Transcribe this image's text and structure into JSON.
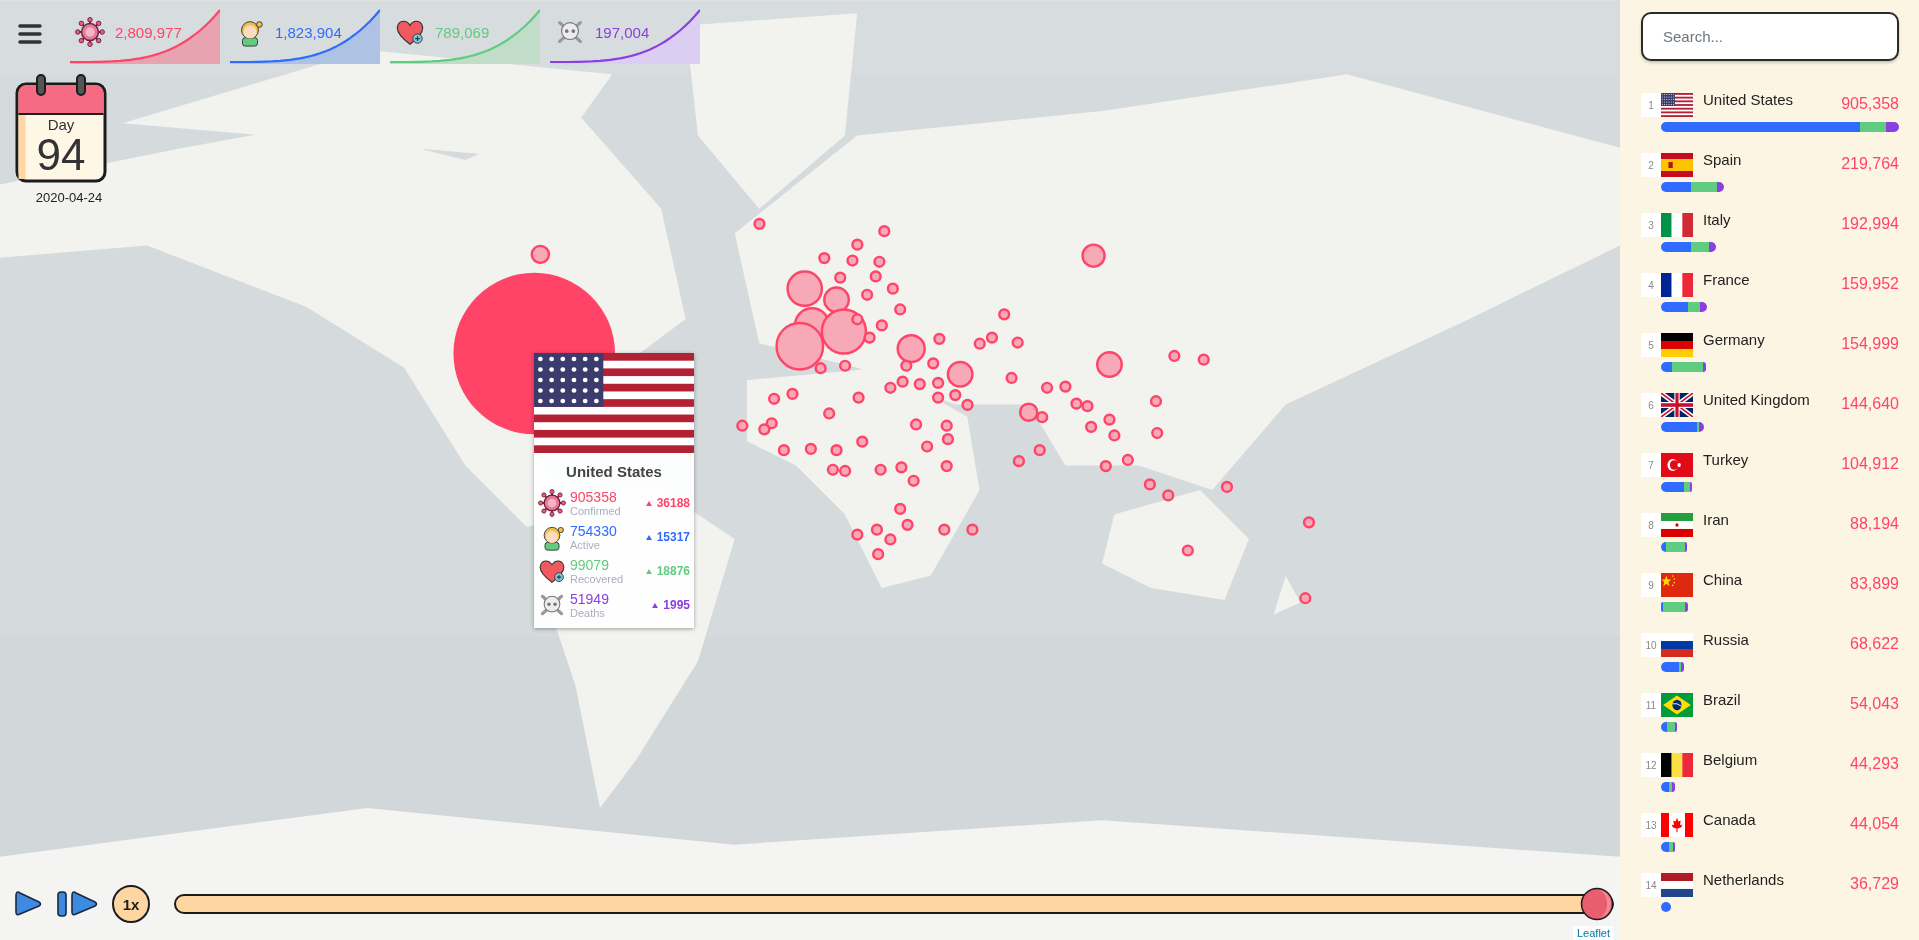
{
  "stats": [
    {
      "kind": "confirmed",
      "value": "2,809,977"
    },
    {
      "kind": "active",
      "value": "1,823,904"
    },
    {
      "kind": "recovered",
      "value": "789,069"
    },
    {
      "kind": "deaths",
      "value": "197,004"
    }
  ],
  "calendar": {
    "label": "Day",
    "day": "94",
    "date": "2020-04-24"
  },
  "tooltip": {
    "flag": {
      "kind": "us"
    },
    "country": "United States",
    "rows": [
      {
        "kind": "confirmed",
        "value": "905358",
        "label": "Confirmed",
        "change": "36188"
      },
      {
        "kind": "active",
        "value": "754330",
        "label": "Active",
        "change": "15317"
      },
      {
        "kind": "recovered",
        "value": "99079",
        "label": "Recovered",
        "change": "18876"
      },
      {
        "kind": "deaths",
        "value": "51949",
        "label": "Deaths",
        "change": "1995"
      }
    ]
  },
  "playback": {
    "speed": "1x",
    "level": 1
  },
  "attribution": "Leaflet",
  "search": {
    "placeholder": "Search..."
  },
  "countries": [
    {
      "rank": "1",
      "flag": {
        "kind": "us"
      },
      "name": "United States",
      "cases": "905,358",
      "segments": [
        {
          "kind": "active"
        },
        {
          "kind": "recovered"
        },
        {
          "kind": "deaths"
        }
      ]
    },
    {
      "rank": "2",
      "flag": {
        "kind": "es"
      },
      "name": "Spain",
      "cases": "219,764",
      "segments": [
        {
          "kind": "active"
        },
        {
          "kind": "recovered"
        },
        {
          "kind": "deaths"
        }
      ]
    },
    {
      "rank": "3",
      "flag": {
        "kind": "it"
      },
      "name": "Italy",
      "cases": "192,994",
      "segments": [
        {
          "kind": "active"
        },
        {
          "kind": "recovered"
        },
        {
          "kind": "deaths"
        }
      ]
    },
    {
      "rank": "4",
      "flag": {
        "kind": "fr"
      },
      "name": "France",
      "cases": "159,952",
      "segments": [
        {
          "kind": "active"
        },
        {
          "kind": "recovered"
        },
        {
          "kind": "deaths"
        }
      ]
    },
    {
      "rank": "5",
      "flag": {
        "kind": "de"
      },
      "name": "Germany",
      "cases": "154,999",
      "segments": [
        {
          "kind": "active"
        },
        {
          "kind": "recovered"
        },
        {
          "kind": "deaths"
        }
      ]
    },
    {
      "rank": "6",
      "flag": {
        "kind": "gb"
      },
      "name": "United Kingdom",
      "cases": "144,640",
      "segments": [
        {
          "kind": "active"
        },
        {
          "kind": "recovered"
        },
        {
          "kind": "deaths"
        }
      ]
    },
    {
      "rank": "7",
      "flag": {
        "kind": "tr"
      },
      "name": "Turkey",
      "cases": "104,912",
      "segments": [
        {
          "kind": "active"
        },
        {
          "kind": "recovered"
        },
        {
          "kind": "deaths"
        }
      ]
    },
    {
      "rank": "8",
      "flag": {
        "kind": "ir"
      },
      "name": "Iran",
      "cases": "88,194",
      "segments": [
        {
          "kind": "active"
        },
        {
          "kind": "recovered"
        },
        {
          "kind": "deaths"
        }
      ]
    },
    {
      "rank": "9",
      "flag": {
        "kind": "cn"
      },
      "name": "China",
      "cases": "83,899",
      "segments": [
        {
          "kind": "active"
        },
        {
          "kind": "recovered"
        },
        {
          "kind": "deaths"
        }
      ]
    },
    {
      "rank": "10",
      "flag": {
        "kind": "ru"
      },
      "name": "Russia",
      "cases": "68,622",
      "segments": [
        {
          "kind": "active"
        },
        {
          "kind": "recovered"
        },
        {
          "kind": "deaths"
        }
      ]
    },
    {
      "rank": "11",
      "flag": {
        "kind": "br"
      },
      "name": "Brazil",
      "cases": "54,043",
      "segments": [
        {
          "kind": "active"
        },
        {
          "kind": "recovered"
        },
        {
          "kind": "deaths"
        }
      ]
    },
    {
      "rank": "12",
      "flag": {
        "kind": "be"
      },
      "name": "Belgium",
      "cases": "44,293",
      "segments": [
        {
          "kind": "active"
        },
        {
          "kind": "recovered"
        },
        {
          "kind": "deaths"
        }
      ]
    },
    {
      "rank": "13",
      "flag": {
        "kind": "ca"
      },
      "name": "Canada",
      "cases": "44,054",
      "segments": [
        {
          "kind": "active"
        },
        {
          "kind": "recovered"
        },
        {
          "kind": "deaths"
        }
      ]
    },
    {
      "rank": "14",
      "flag": {
        "kind": "nl"
      },
      "name": "Netherlands",
      "cases": "36,729",
      "segments": [
        {
          "kind": "active"
        }
      ]
    }
  ]
}
